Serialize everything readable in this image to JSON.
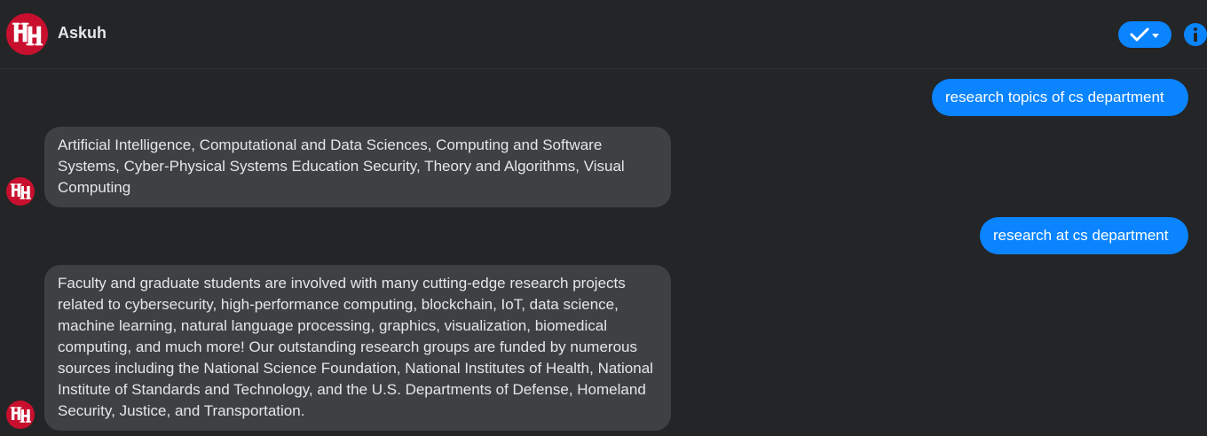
{
  "header": {
    "title": "Askuh",
    "logo_icon": "uh-logo-icon",
    "status_button_icon": "checkmark-dropdown-icon",
    "info_icon": "info-icon"
  },
  "colors": {
    "background": "#242526",
    "user_bubble": "#0a84ff",
    "bot_bubble": "#3e4042",
    "brand_red": "#c8102e"
  },
  "messages": [
    {
      "role": "user",
      "text": "research topics of cs department"
    },
    {
      "role": "bot",
      "text": "Artificial Intelligence, Computational and Data Sciences, Computing and Software Systems, Cyber-Physical Systems Education Security, Theory and Algorithms, Visual Computing"
    },
    {
      "role": "user",
      "text": "research at cs department"
    },
    {
      "role": "bot",
      "text": "Faculty and graduate students are involved with many cutting-edge research projects related to cybersecurity, high-performance computing, blockchain, IoT, data science, machine learning, natural language processing, graphics, visualization, biomedical computing, and much more! Our outstanding research groups are funded by numerous sources including the National Science Foundation, National Institutes of Health, National Institute of Standards and Technology, and the U.S. Departments of Defense, Homeland Security, Justice, and Transportation."
    }
  ]
}
